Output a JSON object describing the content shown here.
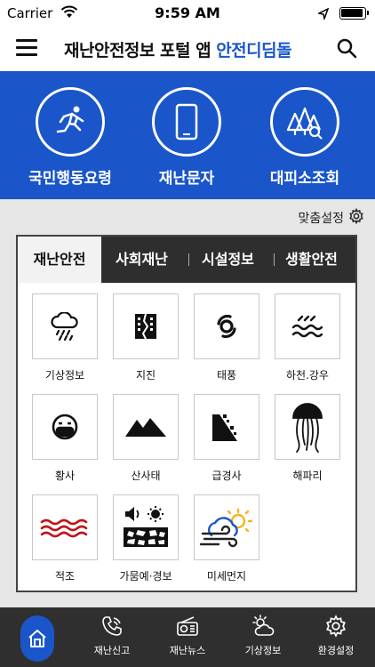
{
  "status_bar": {
    "carrier": "Carrier",
    "time": "9:59 AM"
  },
  "app_bar": {
    "title": "재난안전정보 포털 앱",
    "title_accent": "안전디딤돌"
  },
  "quick_menu": [
    {
      "label": "국민행동요령",
      "icon": "running-person-icon"
    },
    {
      "label": "재난문자",
      "icon": "smartphone-icon"
    },
    {
      "label": "대피소조회",
      "icon": "shelter-search-icon"
    }
  ],
  "custom_settings": {
    "label": "맞춤설정"
  },
  "tabs": [
    {
      "label": "재난안전",
      "active": true
    },
    {
      "label": "사회재난",
      "active": false
    },
    {
      "label": "시설정보",
      "active": false
    },
    {
      "label": "생활안전",
      "active": false
    }
  ],
  "categories": [
    {
      "label": "기상정보",
      "icon": "rain-cloud-icon"
    },
    {
      "label": "지진",
      "icon": "cracked-building-icon"
    },
    {
      "label": "태풍",
      "icon": "typhoon-icon"
    },
    {
      "label": "하천.강우",
      "icon": "river-icon"
    },
    {
      "label": "황사",
      "icon": "mask-face-icon"
    },
    {
      "label": "산사태",
      "icon": "mountain-icon"
    },
    {
      "label": "급경사",
      "icon": "rockfall-icon"
    },
    {
      "label": "해파리",
      "icon": "jellyfish-icon"
    },
    {
      "label": "적조",
      "icon": "red-tide-icon"
    },
    {
      "label": "가뭄예·경보",
      "icon": "drought-icon"
    },
    {
      "label": "미세먼지",
      "icon": "fine-dust-icon"
    }
  ],
  "bottom_nav": [
    {
      "label": "",
      "icon": "home-icon"
    },
    {
      "label": "재난신고",
      "icon": "phone-icon"
    },
    {
      "label": "재난뉴스",
      "icon": "radio-icon"
    },
    {
      "label": "기상정보",
      "icon": "weather-icon"
    },
    {
      "label": "환경설정",
      "icon": "settings-gear-icon"
    }
  ],
  "colors": {
    "brand_blue": "#1a56c9",
    "dark_bar": "#2e2e2e",
    "red_tide": "#c0141a"
  }
}
